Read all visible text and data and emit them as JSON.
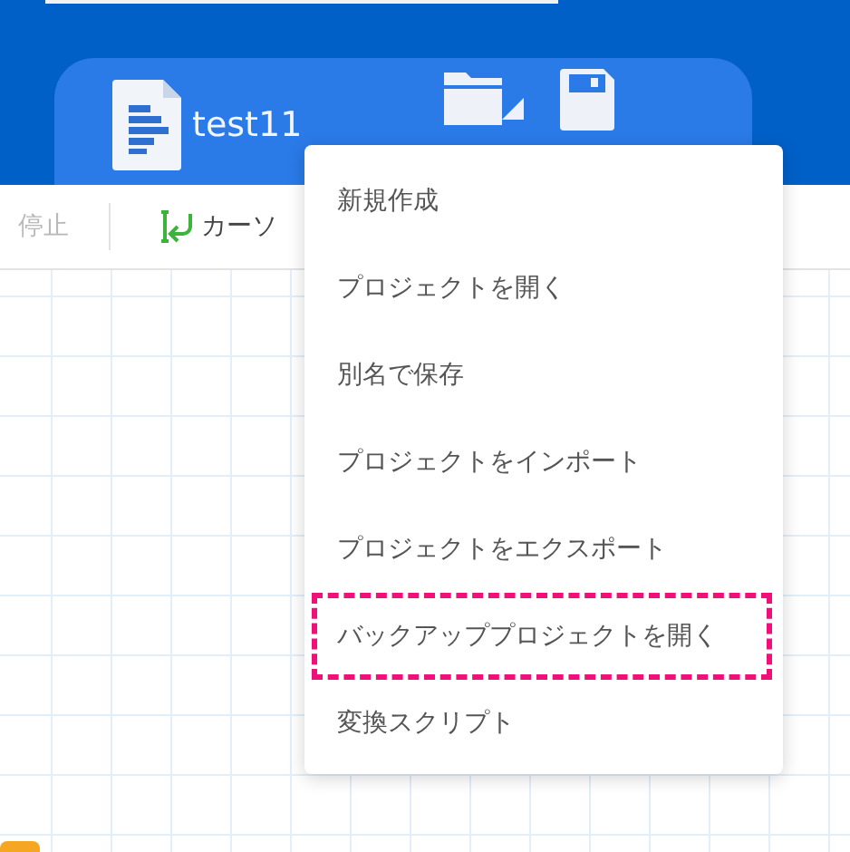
{
  "header": {
    "file_name": "test11",
    "buttons": [
      {
        "kind": "open"
      },
      {
        "kind": "save"
      }
    ]
  },
  "toolbar": {
    "items": [
      {
        "kind": "stop",
        "label": "停止",
        "disabled": true
      },
      {
        "kind": "cursor",
        "label": "カーソ",
        "disabled": false
      }
    ]
  },
  "menu": {
    "items": [
      {
        "label": "新規作成",
        "highlighted": false
      },
      {
        "label": "プロジェクトを開く",
        "highlighted": false
      },
      {
        "label": "別名で保存",
        "highlighted": false
      },
      {
        "label": "プロジェクトをインポート",
        "highlighted": false
      },
      {
        "label": "プロジェクトをエクスポート",
        "highlighted": false
      },
      {
        "label": "バックアッププロジェクトを開く",
        "highlighted": true
      },
      {
        "label": "変換スクリプト",
        "highlighted": false
      }
    ]
  }
}
